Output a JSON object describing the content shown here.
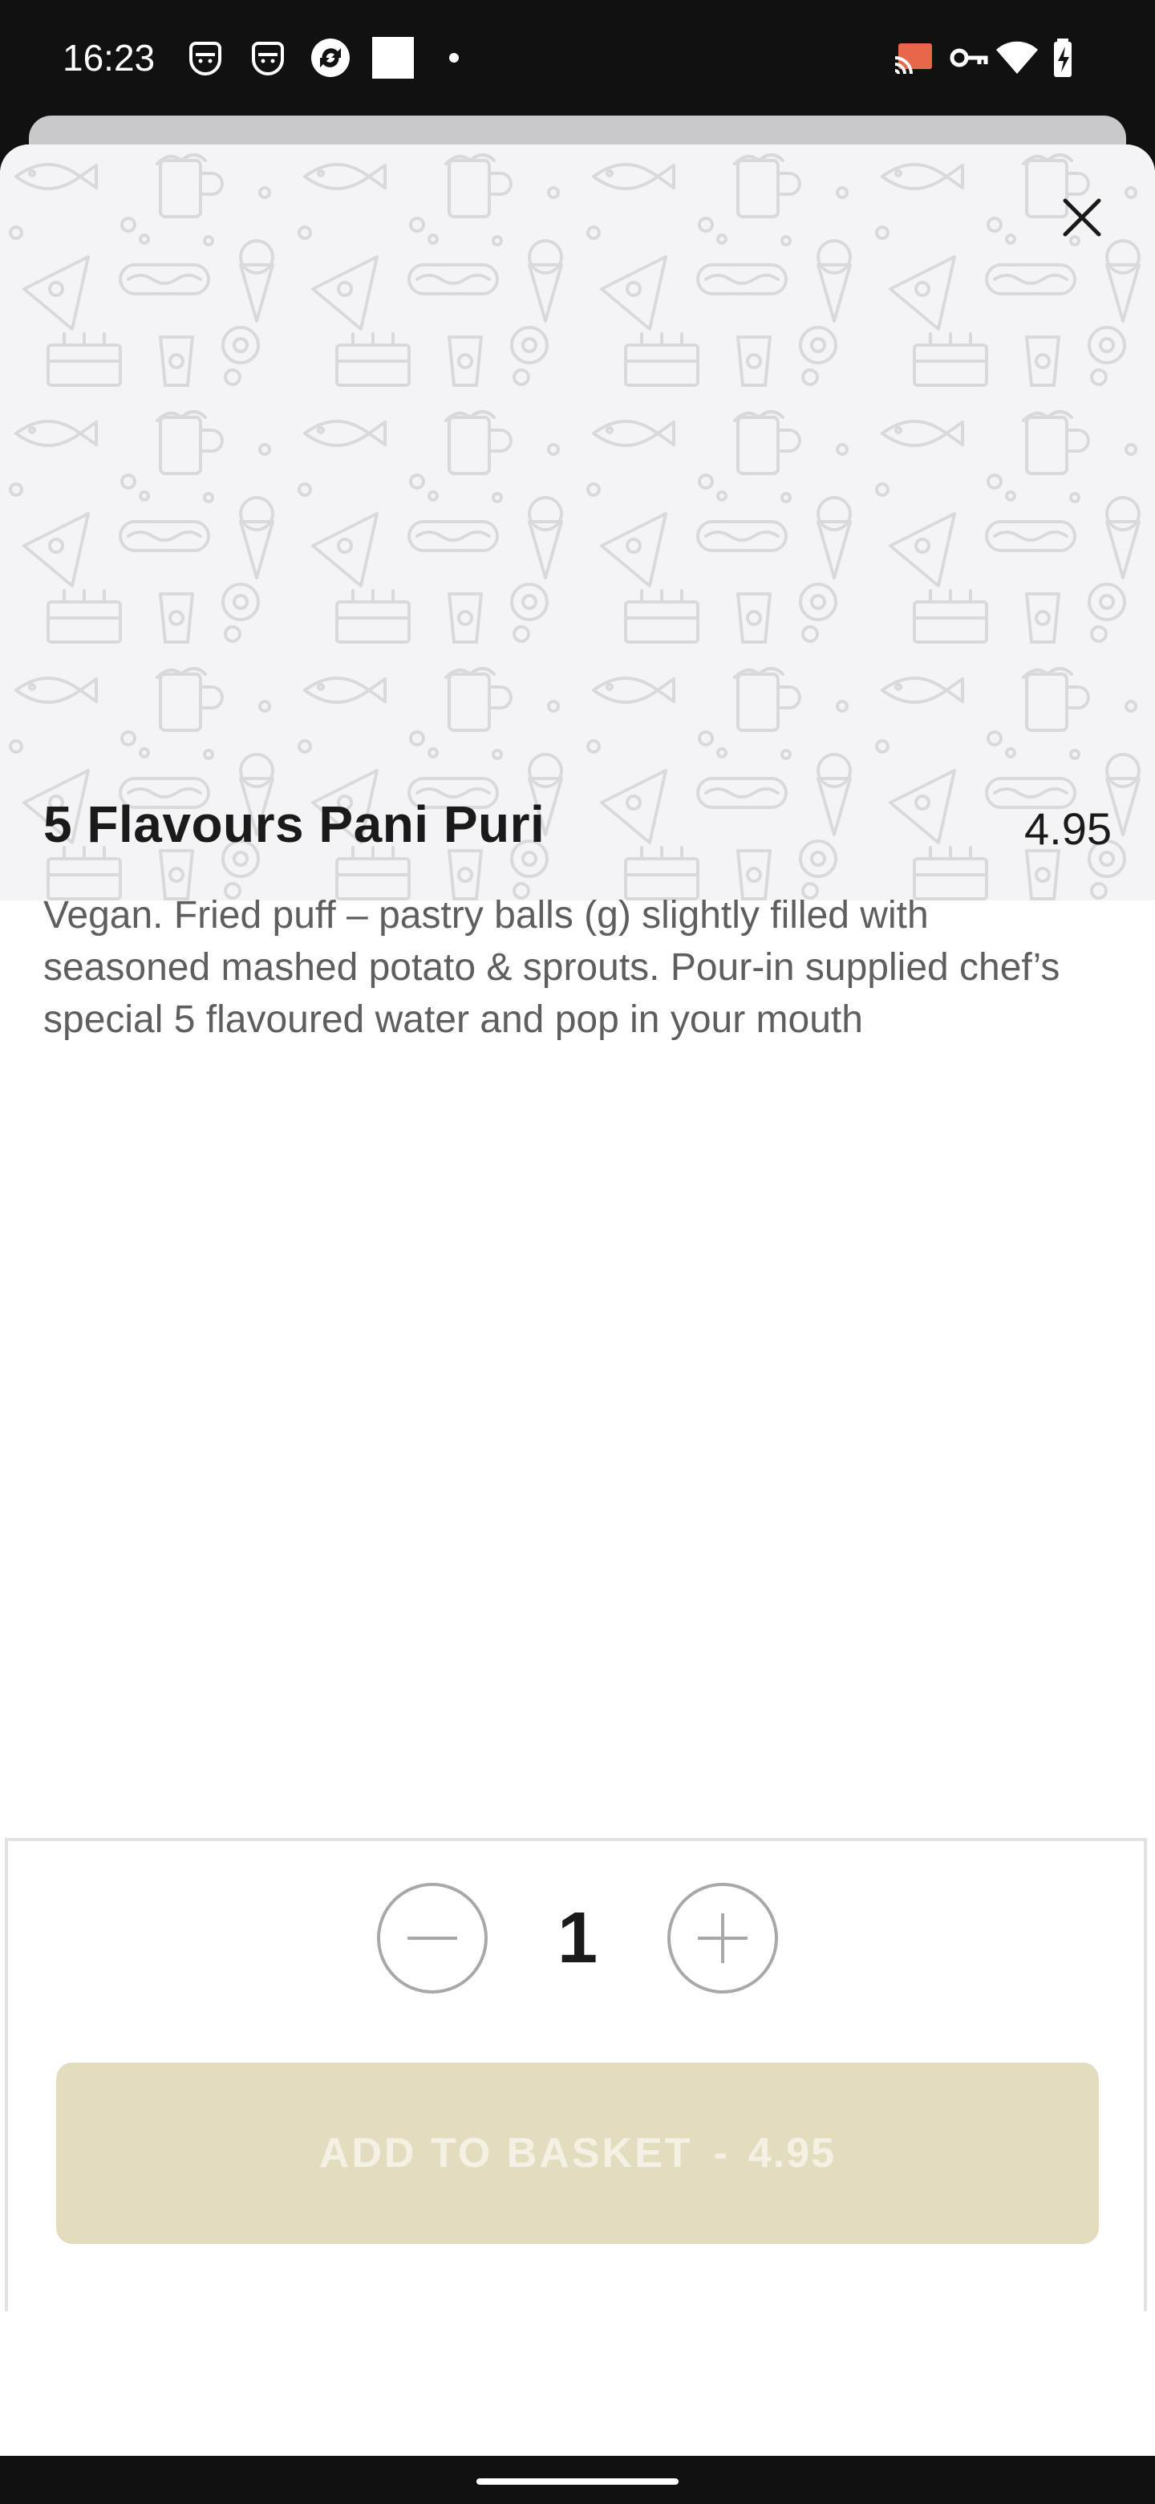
{
  "status_bar": {
    "time": "16:23",
    "left_icons": [
      "face-id-icon",
      "face-id-icon",
      "sync-icon",
      "square-icon",
      "dot-icon"
    ],
    "right_icons": [
      "cast-icon",
      "vpn-key-icon",
      "wifi-icon",
      "battery-charging-icon"
    ]
  },
  "item": {
    "title": "5 Flavours Pani Puri",
    "price": "4.95",
    "description": "Vegan. Fried puff – pastry balls (g) slightly filled with seasoned mashed potato & sprouts. Pour-in supplied chef’s special 5 flavoured water and pop in your mouth"
  },
  "quantity": {
    "value": "1"
  },
  "add_button": {
    "label": "ADD TO BASKET",
    "separator": "-",
    "price": "4.95"
  },
  "colors": {
    "status_bar_bg": "#111111",
    "hero_bg": "#f4f4f6",
    "add_button_bg": "#e3ddbf",
    "add_button_text": "#f4f1e4",
    "description_text": "#5e5e5e",
    "stepper_outline": "#a8a8a8"
  },
  "icons": {
    "close": "close-icon",
    "decrease": "minus-icon",
    "increase": "plus-icon"
  }
}
